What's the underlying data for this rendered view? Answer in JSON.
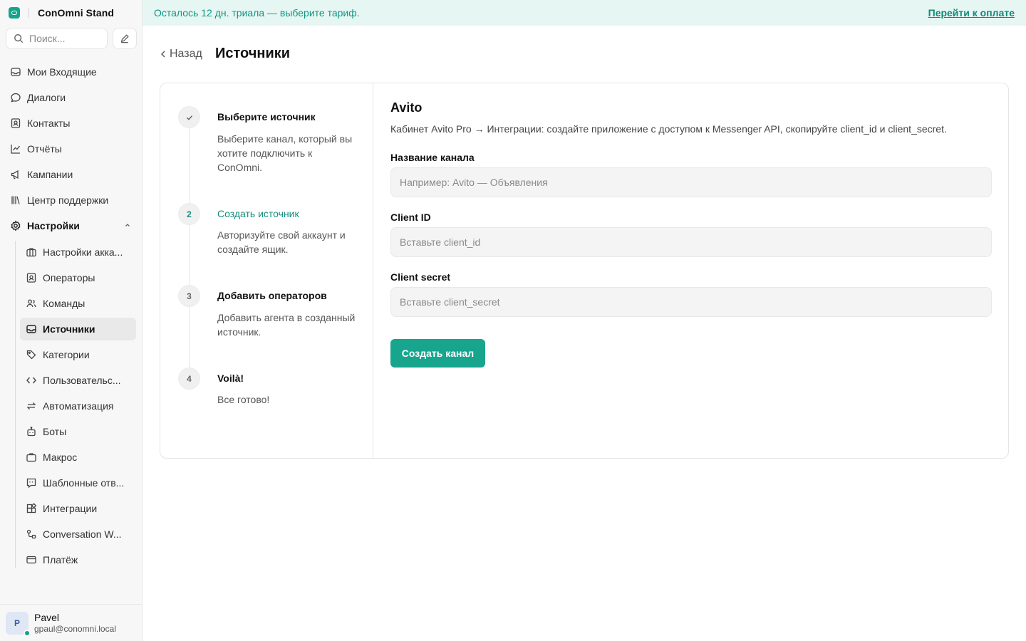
{
  "brand": {
    "name": "ConOmni Stand"
  },
  "search": {
    "placeholder": "Поиск..."
  },
  "nav": {
    "inbox": "Мои Входящие",
    "dialogs": "Диалоги",
    "contacts": "Контакты",
    "reports": "Отчёты",
    "campaigns": "Кампании",
    "help_center": "Центр поддержки",
    "settings": "Настройки"
  },
  "settings_items": [
    {
      "label": "Настройки акка...",
      "icon": "briefcase-icon"
    },
    {
      "label": "Операторы",
      "icon": "contact-card-icon"
    },
    {
      "label": "Команды",
      "icon": "users-icon"
    },
    {
      "label": "Источники",
      "icon": "inbox-icon"
    },
    {
      "label": "Категории",
      "icon": "tag-icon"
    },
    {
      "label": "Пользовательс...",
      "icon": "code-icon"
    },
    {
      "label": "Автоматизация",
      "icon": "arrows-icon"
    },
    {
      "label": "Боты",
      "icon": "bot-icon"
    },
    {
      "label": "Макрос",
      "icon": "briefcase-icon"
    },
    {
      "label": "Шаблонные отв...",
      "icon": "message-quote-icon"
    },
    {
      "label": "Интеграции",
      "icon": "puzzle-icon"
    },
    {
      "label": "Conversation W...",
      "icon": "workflow-icon"
    },
    {
      "label": "Платёж",
      "icon": "credit-card-icon"
    }
  ],
  "user": {
    "initial": "P",
    "name": "Pavel",
    "email": "gpaul@conomni.local"
  },
  "banner": {
    "text": "Осталось 12 дн. триала — выберите тариф.",
    "link": "Перейти к оплате"
  },
  "header": {
    "back": "Назад",
    "title": "Источники"
  },
  "steps": [
    {
      "num": "✓",
      "title": "Выберите источник",
      "desc": "Выберите канал, который вы хотите подключить к ConOmni."
    },
    {
      "num": "2",
      "title": "Создать источник",
      "desc": "Авторизуйте свой аккаунт и создайте ящик."
    },
    {
      "num": "3",
      "title": "Добавить операторов",
      "desc": "Добавить агента в созданный источник."
    },
    {
      "num": "4",
      "title": "Voilà!",
      "desc": "Все готово!"
    }
  ],
  "form": {
    "title": "Avito",
    "desc": "Кабинет Avito Pro → Интеграции: создайте приложение с доступом к Messenger API, скопируйте client_id и client_secret.",
    "channel_label": "Название канала",
    "channel_placeholder": "Например: Avito — Объявления",
    "client_id_label": "Client ID",
    "client_id_placeholder": "Вставьте client_id",
    "client_secret_label": "Client secret",
    "client_secret_placeholder": "Вставьте client_secret",
    "submit": "Создать канал"
  },
  "colors": {
    "accent": "#17a58e",
    "banner_bg": "#e6f6f2",
    "sidebar_bg": "#f7f7f7"
  }
}
